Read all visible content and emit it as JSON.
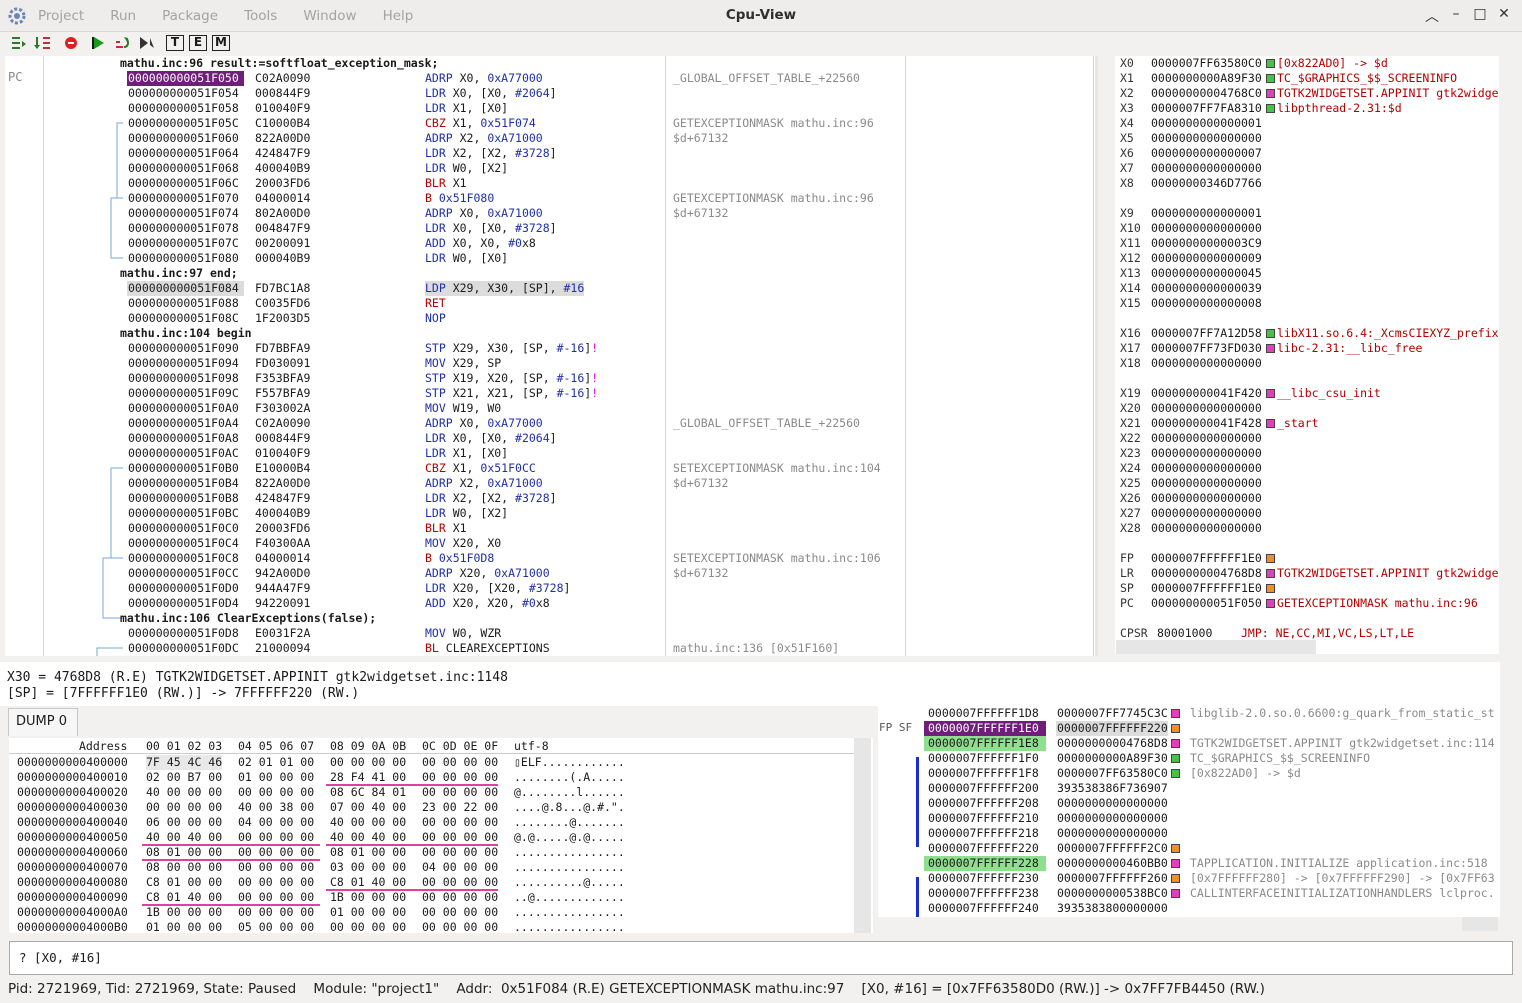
{
  "window": {
    "menu": [
      "Project",
      "Run",
      "Package",
      "Tools",
      "Window",
      "Help"
    ],
    "title": "Cpu-View",
    "controls": [
      "︿",
      "–",
      "□",
      "✕"
    ]
  },
  "toolbar": {
    "letters": [
      "T",
      "E",
      "M"
    ]
  },
  "asm": {
    "pc_label": "PC",
    "rows": [
      {
        "t": "src",
        "text": "mathu.inc:96 result:=softfloat_exception_mask;"
      },
      {
        "a": "000000000051F050",
        "h": "C02A0090",
        "i": "ADRP X0, 0xA77000",
        "info": "_GLOBAL_OFFSET_TABLE_+22560",
        "s": "sel"
      },
      {
        "a": "000000000051F054",
        "h": "000844F9",
        "i": "LDR X0, [X0, #2064]"
      },
      {
        "a": "000000000051F058",
        "h": "010040F9",
        "i": "LDR X1, [X0]"
      },
      {
        "a": "000000000051F05C",
        "h": "C10000B4",
        "i": "CBZ X1, 0x51F074",
        "info": "GETEXCEPTIONMASK mathu.inc:96"
      },
      {
        "a": "000000000051F060",
        "h": "822A00D0",
        "i": "ADRP X2, 0xA71000",
        "info": "$d+67132"
      },
      {
        "a": "000000000051F064",
        "h": "424847F9",
        "i": "LDR X2, [X2, #3728]"
      },
      {
        "a": "000000000051F068",
        "h": "400040B9",
        "i": "LDR W0, [X2]"
      },
      {
        "a": "000000000051F06C",
        "h": "20003FD6",
        "i": "BLR X1"
      },
      {
        "a": "000000000051F070",
        "h": "04000014",
        "i": "B 0x51F080",
        "info": "GETEXCEPTIONMASK mathu.inc:96"
      },
      {
        "a": "000000000051F074",
        "h": "802A00D0",
        "i": "ADRP X0, 0xA71000",
        "info": "$d+67132"
      },
      {
        "a": "000000000051F078",
        "h": "004847F9",
        "i": "LDR X0, [X0, #3728]"
      },
      {
        "a": "000000000051F07C",
        "h": "00200091",
        "i": "ADD X0, X0, #0x8"
      },
      {
        "a": "000000000051F080",
        "h": "000040B9",
        "i": "LDR W0, [X0]"
      },
      {
        "t": "src",
        "text": "mathu.inc:97 end;"
      },
      {
        "a": "000000000051F084",
        "h": "FD7BC1A8",
        "i": "LDP X29, X30, [SP], #16",
        "s": "cur"
      },
      {
        "a": "000000000051F088",
        "h": "C0035FD6",
        "i": "RET"
      },
      {
        "a": "000000000051F08C",
        "h": "1F2003D5",
        "i": "NOP"
      },
      {
        "t": "src",
        "text": "mathu.inc:104 begin"
      },
      {
        "a": "000000000051F090",
        "h": "FD7BBFA9",
        "i": "STP X29, X30, [SP, #-16]!"
      },
      {
        "a": "000000000051F094",
        "h": "FD030091",
        "i": "MOV X29, SP"
      },
      {
        "a": "000000000051F098",
        "h": "F353BFA9",
        "i": "STP X19, X20, [SP, #-16]!"
      },
      {
        "a": "000000000051F09C",
        "h": "F557BFA9",
        "i": "STP X21, X21, [SP, #-16]!"
      },
      {
        "a": "000000000051F0A0",
        "h": "F303002A",
        "i": "MOV W19, W0"
      },
      {
        "a": "000000000051F0A4",
        "h": "C02A0090",
        "i": "ADRP X0, 0xA77000",
        "info": "_GLOBAL_OFFSET_TABLE_+22560"
      },
      {
        "a": "000000000051F0A8",
        "h": "000844F9",
        "i": "LDR X0, [X0, #2064]"
      },
      {
        "a": "000000000051F0AC",
        "h": "010040F9",
        "i": "LDR X1, [X0]"
      },
      {
        "a": "000000000051F0B0",
        "h": "E10000B4",
        "i": "CBZ X1, 0x51F0CC",
        "info": "SETEXCEPTIONMASK mathu.inc:104"
      },
      {
        "a": "000000000051F0B4",
        "h": "822A00D0",
        "i": "ADRP X2, 0xA71000",
        "info": "$d+67132"
      },
      {
        "a": "000000000051F0B8",
        "h": "424847F9",
        "i": "LDR X2, [X2, #3728]"
      },
      {
        "a": "000000000051F0BC",
        "h": "400040B9",
        "i": "LDR W0, [X2]"
      },
      {
        "a": "000000000051F0C0",
        "h": "20003FD6",
        "i": "BLR X1"
      },
      {
        "a": "000000000051F0C4",
        "h": "F40300AA",
        "i": "MOV X20, X0"
      },
      {
        "a": "000000000051F0C8",
        "h": "04000014",
        "i": "B 0x51F0D8",
        "info": "SETEXCEPTIONMASK mathu.inc:106"
      },
      {
        "a": "000000000051F0CC",
        "h": "942A00D0",
        "i": "ADRP X20, 0xA71000",
        "info": "$d+67132"
      },
      {
        "a": "000000000051F0D0",
        "h": "944A47F9",
        "i": "LDR X20, [X20, #3728]"
      },
      {
        "a": "000000000051F0D4",
        "h": "94220091",
        "i": "ADD X20, X20, #0x8"
      },
      {
        "t": "src",
        "text": "mathu.inc:106 ClearExceptions(false);"
      },
      {
        "a": "000000000051F0D8",
        "h": "E0031F2A",
        "i": "MOV W0, WZR"
      },
      {
        "a": "000000000051F0DC",
        "h": "21000094",
        "i": "BL CLEAREXCEPTIONS",
        "info": "mathu.inc:136 [0x51F160]"
      }
    ]
  },
  "regs": [
    {
      "n": "X0",
      "v": "0000007FF63580C0",
      "c": "green",
      "s": "[0x822AD0] -> $d"
    },
    {
      "n": "X1",
      "v": "0000000000A89F30",
      "c": "green",
      "s": "TC_$GRAPHICS_$$_SCREENINFO"
    },
    {
      "n": "X2",
      "v": "00000000004768C0",
      "c": "pink",
      "s": "TGTK2WIDGETSET.APPINIT gtk2widge"
    },
    {
      "n": "X3",
      "v": "0000007FF7FA8310",
      "c": "green",
      "s": "libpthread-2.31:$d"
    },
    {
      "n": "X4",
      "v": "0000000000000001"
    },
    {
      "n": "X5",
      "v": "0000000000000000"
    },
    {
      "n": "X6",
      "v": "0000000000000007"
    },
    {
      "n": "X7",
      "v": "0000000000000000"
    },
    {
      "n": "X8",
      "v": "00000000346D7766"
    },
    {
      "gap": true
    },
    {
      "n": "X9",
      "v": "0000000000000001"
    },
    {
      "n": "X10",
      "v": "0000000000000000"
    },
    {
      "n": "X11",
      "v": "00000000000003C9"
    },
    {
      "n": "X12",
      "v": "0000000000000009"
    },
    {
      "n": "X13",
      "v": "0000000000000045"
    },
    {
      "n": "X14",
      "v": "0000000000000039"
    },
    {
      "n": "X15",
      "v": "0000000000000008"
    },
    {
      "gap": true
    },
    {
      "n": "X16",
      "v": "0000007FF7A12D58",
      "c": "green",
      "s": "libX11.so.6.4:_XcmsCIEXYZ_prefix"
    },
    {
      "n": "X17",
      "v": "0000007FF73FD030",
      "c": "pink",
      "s": "libc-2.31:__libc_free"
    },
    {
      "n": "X18",
      "v": "0000000000000000"
    },
    {
      "gap": true
    },
    {
      "n": "X19",
      "v": "000000000041F420",
      "c": "pink",
      "s": "__libc_csu_init"
    },
    {
      "n": "X20",
      "v": "0000000000000000"
    },
    {
      "n": "X21",
      "v": "000000000041F428",
      "c": "pink",
      "s": "_start"
    },
    {
      "n": "X22",
      "v": "0000000000000000"
    },
    {
      "n": "X23",
      "v": "0000000000000000"
    },
    {
      "n": "X24",
      "v": "0000000000000000"
    },
    {
      "n": "X25",
      "v": "0000000000000000"
    },
    {
      "n": "X26",
      "v": "0000000000000000"
    },
    {
      "n": "X27",
      "v": "0000000000000000"
    },
    {
      "n": "X28",
      "v": "0000000000000000"
    },
    {
      "gap": true
    },
    {
      "n": "FP",
      "v": "0000007FFFFFF1E0",
      "c": "orange",
      "s": ""
    },
    {
      "n": "LR",
      "v": "00000000004768D8",
      "c": "pink",
      "s": "TGTK2WIDGETSET.APPINIT gtk2widget"
    },
    {
      "n": "SP",
      "v": "0000007FFFFFF1E0",
      "c": "orange",
      "s": ""
    },
    {
      "n": "PC",
      "v": "000000000051F050",
      "c": "pink",
      "s": "GETEXCEPTIONMASK mathu.inc:96"
    },
    {
      "gap": true
    },
    {
      "n": "CPSR",
      "v": "80001000",
      "flags": "JMP: NE,CC,MI,VC,LS,LT,LE"
    }
  ],
  "watch": {
    "lines": [
      "X30 = 4768D8 (R.E) TGTK2WIDGETSET.APPINIT gtk2widgetset.inc:1148",
      "[SP] = [7FFFFFF1E0 (RW.)] -> 7FFFFFF220 (RW.)"
    ]
  },
  "dump": {
    "tab": "DUMP 0",
    "hdr_addr": "Address",
    "hdr_cols": [
      "00 01 02 03",
      "04 05 06 07",
      "08 09 0A 0B",
      "0C 0D 0E 0F"
    ],
    "hdr_enc": "utf-8",
    "rows": [
      {
        "a": "0000000000400000",
        "b": [
          "7F 45 4C 46",
          "02 01 01 00",
          "00 00 00 00",
          "00 00 00 00"
        ],
        "t": "▯ELF............"
      },
      {
        "a": "0000000000400010",
        "b": [
          "02 00 B7 00",
          "01 00 00 00",
          "28 F4 41 00",
          "00 00 00 00"
        ],
        "t": "........(.A....."
      },
      {
        "a": "0000000000400020",
        "b": [
          "40 00 00 00",
          "00 00 00 00",
          "08 6C 84 01",
          "00 00 00 00"
        ],
        "t": "@........l......"
      },
      {
        "a": "0000000000400030",
        "b": [
          "00 00 00 00",
          "40 00 38 00",
          "07 00 40 00",
          "23 00 22 00"
        ],
        "t": "....@.8...@.#.\"."
      },
      {
        "a": "0000000000400040",
        "b": [
          "06 00 00 00",
          "04 00 00 00",
          "40 00 00 00",
          "00 00 00 00"
        ],
        "t": "........@......."
      },
      {
        "a": "0000000000400050",
        "b": [
          "40 00 40 00",
          "00 00 00 00",
          "40 00 40 00",
          "00 00 00 00"
        ],
        "t": "@.@.....@.@....."
      },
      {
        "a": "0000000000400060",
        "b": [
          "08 01 00 00",
          "00 00 00 00",
          "08 01 00 00",
          "00 00 00 00"
        ],
        "t": "................"
      },
      {
        "a": "0000000000400070",
        "b": [
          "08 00 00 00",
          "00 00 00 00",
          "03 00 00 00",
          "04 00 00 00"
        ],
        "t": "................"
      },
      {
        "a": "0000000000400080",
        "b": [
          "C8 01 00 00",
          "00 00 00 00",
          "C8 01 40 00",
          "00 00 00 00"
        ],
        "t": "..........@....."
      },
      {
        "a": "0000000000400090",
        "b": [
          "C8 01 40 00",
          "00 00 00 00",
          "1B 00 00 00",
          "00 00 00 00"
        ],
        "t": "..@............."
      },
      {
        "a": "00000000004000A0",
        "b": [
          "1B 00 00 00",
          "00 00 00 00",
          "01 00 00 00",
          "00 00 00 00"
        ],
        "t": "................"
      },
      {
        "a": "00000000004000B0",
        "b": [
          "01 00 00 00",
          "05 00 00 00",
          "00 00 00 00",
          "00 00 00 00"
        ],
        "t": "................"
      }
    ]
  },
  "stack": {
    "label": "FP SF",
    "rows": [
      {
        "a": "0000007FFFFFF1D8",
        "v": "0000007FF7745C3C",
        "c": "pink",
        "d": "libglib-2.0.so.0.6600:g_quark_from_static_st"
      },
      {
        "a": "0000007FFFFFF1E0",
        "v": "0000007FFFFFF220",
        "c": "orange",
        "d": "",
        "s": "sel"
      },
      {
        "a": "0000007FFFFFF1E8",
        "v": "00000000004768D8",
        "c": "pink",
        "d": "TGTK2WIDGETSET.APPINIT gtk2widgetset.inc:114",
        "s": "grn"
      },
      {
        "a": "0000007FFFFFF1F0",
        "v": "0000000000A89F30",
        "c": "green",
        "d": "TC_$GRAPHICS_$$_SCREENINFO"
      },
      {
        "a": "0000007FFFFFF1F8",
        "v": "0000007FF63580C0",
        "c": "green",
        "d": "[0x822AD0] -> $d"
      },
      {
        "a": "0000007FFFFFF200",
        "v": "393538386F736907",
        "d": ""
      },
      {
        "a": "0000007FFFFFF208",
        "v": "0000000000000000",
        "d": ""
      },
      {
        "a": "0000007FFFFFF210",
        "v": "0000000000000000",
        "d": ""
      },
      {
        "a": "0000007FFFFFF218",
        "v": "0000000000000000",
        "d": ""
      },
      {
        "a": "0000007FFFFFF220",
        "v": "0000007FFFFFF2C0",
        "c": "orange",
        "d": ""
      },
      {
        "a": "0000007FFFFFF228",
        "v": "0000000000460BB0",
        "c": "pink",
        "d": "TAPPLICATION.INITIALIZE application.inc:518",
        "s": "grn"
      },
      {
        "a": "0000007FFFFFF230",
        "v": "0000007FFFFFF260",
        "c": "orange",
        "d": "[0x7FFFFFF280] -> [0x7FFFFFF290] -> [0x7FF63"
      },
      {
        "a": "0000007FFFFFF238",
        "v": "0000000000538BC0",
        "c": "pink",
        "d": "CALLINTERFACEINITIALIZATIONHANDLERS lclproc."
      },
      {
        "a": "0000007FFFFFF240",
        "v": "3935383800000000",
        "d": ""
      }
    ]
  },
  "cmd": {
    "text": "? [X0, #16]"
  },
  "status": {
    "text": "Pid: 2721969, Tid: 2721969, State: Paused    Module: \"project1\"    Addr:  0x51F084 (R.E) GETEXCEPTIONMASK mathu.inc:97    [X0, #16] = [0x7FF63580D0 (RW.)] -> 0x7FF7FB4450 (RW.)"
  },
  "colors": {
    "green": "#46c246",
    "pink": "#e040c0",
    "orange": "#f0901e",
    "sel": "#6f1e7a",
    "stack_green": "#8ee08e"
  }
}
